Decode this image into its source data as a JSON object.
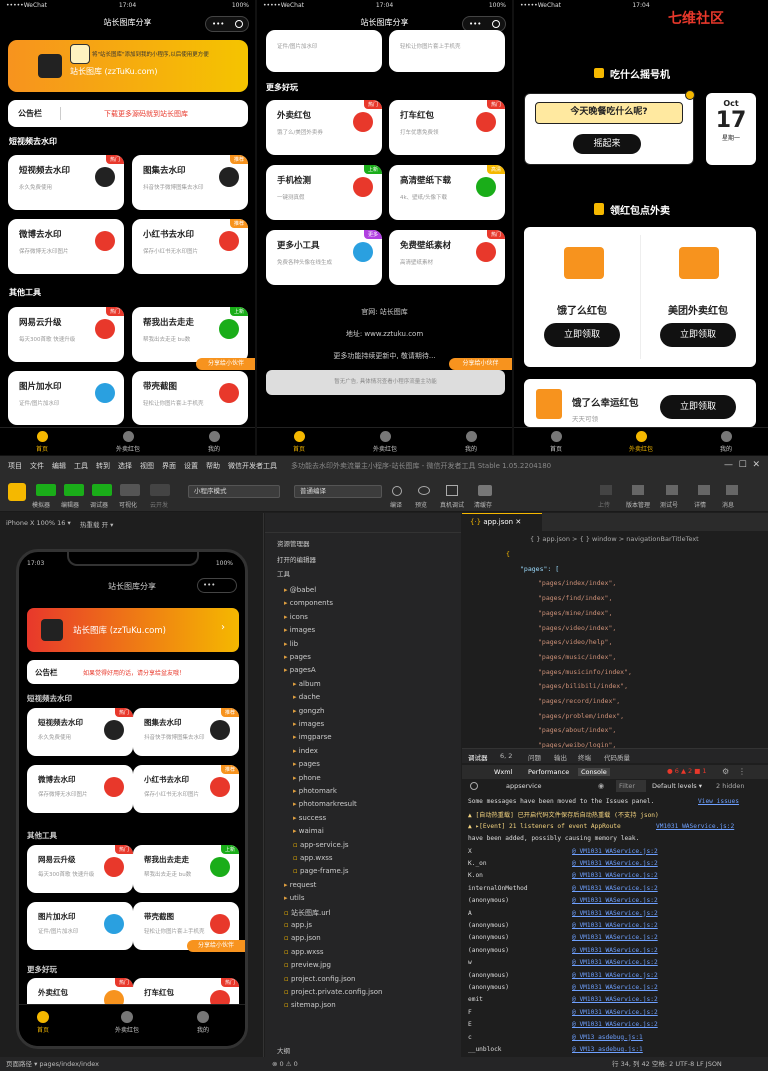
{
  "status": {
    "carrier": "WeChat",
    "time": "17:04",
    "battery": "100%"
  },
  "phone1": {
    "title": "站长图库分享",
    "banner": "将\"站长图库\"添加到我的小程序,以后使用更方便",
    "banner_sub": "站长图库 (zzTuKu.com)",
    "notice_label": "公告栏",
    "notice_text": "下载更多源码就到站长图库",
    "sec1": "短视频去水印",
    "sec2": "其他工具",
    "cards": [
      {
        "t": "短视频去水印",
        "s": "永久免费使用",
        "b": "热门"
      },
      {
        "t": "图集去水印",
        "s": "抖音快手微博图集去水印",
        "b": "推荐"
      },
      {
        "t": "微博去水印",
        "s": "保存微博无水印图片",
        "b": ""
      },
      {
        "t": "小红书去水印",
        "s": "保存小红书无水印图片",
        "b": "推荐"
      },
      {
        "t": "网易云升级",
        "s": "每天300首歌 快速升级",
        "b": "热门"
      },
      {
        "t": "帮我出去走走",
        "s": "帮我出去走走 bu数",
        "b": "上新"
      },
      {
        "t": "图片加水印",
        "s": "证件/图片加水印",
        "b": ""
      },
      {
        "t": "带壳截图",
        "s": "轻松让你图片套上手机壳",
        "b": ""
      }
    ],
    "share": "分享给小伙伴",
    "tabs": [
      "首页",
      "外卖红包",
      "我的"
    ]
  },
  "phone2": {
    "title": "站长图库分享",
    "top_cards": [
      {
        "s": "证件/图片加水印"
      },
      {
        "s": "轻松让你图片套上手机壳"
      }
    ],
    "sec": "更多好玩",
    "cards": [
      {
        "t": "外卖红包",
        "s": "饿了么/美团外卖券",
        "b": "热门"
      },
      {
        "t": "打车红包",
        "s": "打车优惠免费领",
        "b": "热门"
      },
      {
        "t": "手机检测",
        "s": "一键测真假",
        "b": "上新"
      },
      {
        "t": "高清壁纸下载",
        "s": "4k、壁纸/头像下载",
        "b": "高清"
      },
      {
        "t": "更多小工具",
        "s": "免费各种头像在线生成",
        "b": "更多"
      },
      {
        "t": "免费壁纸素材",
        "s": "高清壁纸素材",
        "b": "热门"
      }
    ],
    "footer": [
      "官网: 站长图库",
      "地址: www.zztuku.com",
      "更多功能持续更新中, 敬请期待..."
    ],
    "ad": "暂无广告, 具体情况查看小程序流量主功能",
    "share": "分享给小伙伴",
    "tabs": [
      "首页",
      "外卖红包",
      "我的"
    ]
  },
  "phone3": {
    "watermark": "七维社区",
    "sec1": "吃什么摇号机",
    "question": "今天晚餐吃什么呢?",
    "shake": "摇起来",
    "cal": {
      "month": "Oct",
      "day": "17",
      "weekday": "星期一"
    },
    "sec2": "领红包点外卖",
    "ele": "饿了么红包",
    "mt": "美团外卖红包",
    "claim": "立即领取",
    "lucky": "饿了么幸运红包",
    "lucky_sub": "天天可领",
    "tabs": [
      "首页",
      "外卖红包",
      "我的"
    ]
  },
  "ide": {
    "menu": [
      "项目",
      "文件",
      "编辑",
      "工具",
      "转到",
      "选择",
      "视图",
      "界面",
      "设置",
      "帮助",
      "微信开发者工具",
      "多功能去水印外卖流量主小程序-站长图库 - 微信开发者工具 Stable 1.05.2204180"
    ],
    "tb_labels": [
      "模拟器",
      "编辑器",
      "调试器",
      "可视化",
      "云开发"
    ],
    "mode": "小程序模式",
    "compile": "普通编译",
    "tb_right": [
      "编译",
      "预览",
      "真机调试",
      "清缓存"
    ],
    "tb_far": [
      "上传",
      "版本管理",
      "测试号",
      "详情",
      "消息"
    ],
    "device": "iPhone X 100% 16 ▾",
    "hot": "热重载 开 ▾",
    "sim": {
      "time": "17:03",
      "battery": "100%",
      "title": "站长图库分享",
      "banner": "站长图库 (zzTuKu.com)",
      "notice_label": "公告栏",
      "notice": "如果觉得好用的话，请分享给盆友哦！",
      "sec1": "短视频去水印",
      "sec2": "其他工具",
      "sec3": "更多好玩",
      "cards": [
        {
          "t": "短视频去水印",
          "s": "永久免费使用",
          "b": "热门"
        },
        {
          "t": "图集去水印",
          "s": "抖音快手微博图集去水印",
          "b": "推荐"
        },
        {
          "t": "微博去水印",
          "s": "保存微博无水印图片",
          "b": ""
        },
        {
          "t": "小红书去水印",
          "s": "保存小红书无水印图片",
          "b": "推荐"
        },
        {
          "t": "网易云升级",
          "s": "每天300首歌 快速升级",
          "b": "热门"
        },
        {
          "t": "帮我出去走走",
          "s": "帮我出去走走 bu数",
          "b": "上新"
        },
        {
          "t": "图片加水印",
          "s": "证件/图片加水印",
          "b": ""
        },
        {
          "t": "带壳截图",
          "s": "轻松让你图片套上手机壳",
          "b": ""
        },
        {
          "t": "外卖红包",
          "s": "",
          "b": "热门"
        },
        {
          "t": "打车红包",
          "s": "",
          "b": "热门"
        }
      ],
      "share": "分享给小伙伴",
      "tabs": [
        "首页",
        "外卖红包",
        "我的"
      ]
    },
    "explorer": "资源管理器",
    "open_editors": "打开的编辑器",
    "tools": "工具",
    "tree": [
      "@babel",
      "components",
      "icons",
      "images",
      "lib",
      "pages",
      "pagesA",
      "album",
      "dache",
      "gongzh",
      "images",
      "imgparse",
      "index",
      "pages",
      "phone",
      "photomark",
      "photomarkresult",
      "success",
      "waimai",
      "app-service.js",
      "app.wxss",
      "page-frame.js",
      "request",
      "utils",
      "站长图库.url",
      "app.js",
      "app.json",
      "app.wxss",
      "preview.jpg",
      "project.config.json",
      "project.private.config.json",
      "sitemap.json"
    ],
    "outline": "大纲",
    "tab": "app.json",
    "breadcrumb": "{ } app.json  >  { } window  >  navigationBarTitleText",
    "code": [
      "{",
      "\"pages\": [",
      "\"pages/index/index\",",
      "\"pages/find/index\",",
      "\"pages/mine/index\",",
      "\"pages/video/index\",",
      "\"pages/video/help\",",
      "\"pages/music/index\",",
      "\"pages/musicinfo/index\",",
      "\"pages/bilibili/index\",",
      "\"pages/record/index\",",
      "\"pages/problem/index\",",
      "\"pages/about/index\",",
      "\"pages/weibo/login\","
    ],
    "dbg_tabs": [
      "调试器",
      "6, 2",
      "问题",
      "输出",
      "终端",
      "代码质量"
    ],
    "con_tabs": [
      "Wxml",
      "Performance",
      "Console"
    ],
    "counts": "● 6  ▲ 2  ■ 1",
    "ctx": "appservice",
    "filter": "Filter",
    "levels": "Default levels ▾",
    "hidden": "2 hidden",
    "console": [
      {
        "m": "Some messages have been moved to the Issues panel.",
        "l": "View issues"
      },
      {
        "m": "▲ [自动热重载] 已开启代码文件保存后自动热重载 (不支持 json)",
        "l": ""
      },
      {
        "m": "▲ ▸[Event] 21 listeners of event AppRoute",
        "l": "VM1031 WAService.js:2"
      },
      {
        "m": "  have been added, possibly causing memory leak.",
        "l": ""
      },
      {
        "m": "X",
        "l": "@ VM1031 WAService.js:2"
      },
      {
        "m": "K._on",
        "l": "@ VM1031 WAService.js:2"
      },
      {
        "m": "K.on",
        "l": "@ VM1031 WAService.js:2"
      },
      {
        "m": "internalOnMethod",
        "l": "@ VM1031 WAService.js:2"
      },
      {
        "m": "(anonymous)",
        "l": "@ VM1031 WAService.js:2"
      },
      {
        "m": "A",
        "l": "@ VM1031 WAService.js:2"
      },
      {
        "m": "(anonymous)",
        "l": "@ VM1031 WAService.js:2"
      },
      {
        "m": "(anonymous)",
        "l": "@ VM1031 WAService.js:2"
      },
      {
        "m": "(anonymous)",
        "l": "@ VM1031 WAService.js:2"
      },
      {
        "m": "w",
        "l": "@ VM1031 WAService.js:2"
      },
      {
        "m": "(anonymous)",
        "l": "@ VM1031 WAService.js:2"
      },
      {
        "m": "(anonymous)",
        "l": "@ VM1031 WAService.js:2"
      },
      {
        "m": "emit",
        "l": "@ VM1031 WAService.js:2"
      },
      {
        "m": "F",
        "l": "@ VM1031 WAService.js:2"
      },
      {
        "m": "E",
        "l": "@ VM1031 WAService.js:2"
      },
      {
        "m": "c",
        "l": "@ VM13 asdebug.js:1"
      },
      {
        "m": "__unblock",
        "l": "@ VM13 asdebug.js:1"
      }
    ],
    "status_left": "页面路径 ▾   pages/index/index",
    "status_mid": "⊗ 0 ⚠ 0",
    "status_right": "行 34, 列 42   空格: 2   UTF-8   LF   JSON"
  },
  "colors": {
    "accent": "#f5b800",
    "orange": "#f7931e",
    "red": "#e8382b"
  }
}
